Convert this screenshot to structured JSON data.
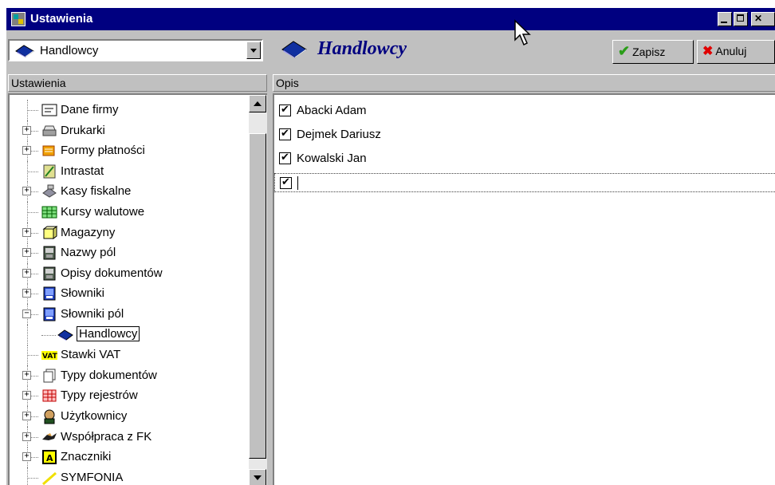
{
  "window": {
    "title": "Ustawienia"
  },
  "left_panel": {
    "combo_value": "Handlowcy",
    "header": "Ustawienia",
    "tree": [
      {
        "label": "Dane firmy",
        "icon": "company-icon",
        "expandable": false
      },
      {
        "label": "Drukarki",
        "icon": "printer-icon",
        "expandable": true
      },
      {
        "label": "Formy płatności",
        "icon": "payment-icon",
        "expandable": true
      },
      {
        "label": "Intrastat",
        "icon": "intrastat-icon",
        "expandable": false
      },
      {
        "label": "Kasy fiskalne",
        "icon": "cash-register-icon",
        "expandable": true
      },
      {
        "label": "Kursy walutowe",
        "icon": "grid-icon",
        "expandable": false
      },
      {
        "label": "Magazyny",
        "icon": "box-icon",
        "expandable": true
      },
      {
        "label": "Nazwy pól",
        "icon": "device-icon",
        "expandable": true
      },
      {
        "label": "Opisy dokumentów",
        "icon": "device-icon",
        "expandable": true
      },
      {
        "label": "Słowniki",
        "icon": "dictionary-icon",
        "expandable": true
      },
      {
        "label": "Słowniki pól",
        "icon": "dictionary-icon",
        "expandable": true,
        "expanded": true
      },
      {
        "label": "Handlowcy",
        "icon": "book-icon",
        "child": true,
        "selected": true
      },
      {
        "label": "Stawki VAT",
        "icon": "vat-icon",
        "expandable": false
      },
      {
        "label": "Typy dokumentów",
        "icon": "documents-icon",
        "expandable": true
      },
      {
        "label": "Typy rejestrów",
        "icon": "register-icon",
        "expandable": true
      },
      {
        "label": "Użytkownicy",
        "icon": "users-icon",
        "expandable": true
      },
      {
        "label": "Współpraca z FK",
        "icon": "handshake-icon",
        "expandable": true
      },
      {
        "label": "Znaczniki",
        "icon": "marker-icon",
        "expandable": true
      },
      {
        "label": "SYMFONIA",
        "icon": "symfonia-icon",
        "expandable": false
      }
    ]
  },
  "right_panel": {
    "title": "Handlowcy",
    "save_label": "Zapisz",
    "cancel_label": "Anuluj",
    "header": "Opis",
    "rows": [
      {
        "text": "Abacki Adam",
        "checked": true
      },
      {
        "text": "Dejmek Dariusz",
        "checked": true
      },
      {
        "text": "Kowalski Jan",
        "checked": true
      },
      {
        "text": "",
        "checked": true,
        "editing": true
      }
    ]
  }
}
